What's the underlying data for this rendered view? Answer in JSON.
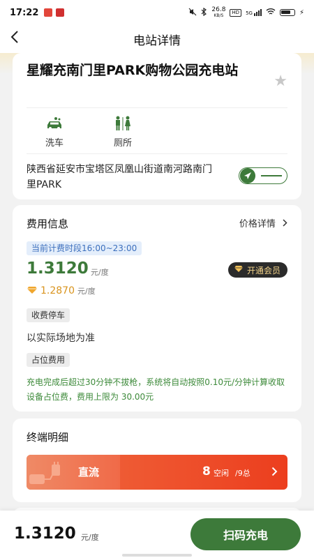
{
  "status_bar": {
    "time": "17:22",
    "net_speed": "26.8",
    "net_unit": "KB/S",
    "signal": "5G"
  },
  "header": {
    "title": "电站详情",
    "back_icon": "chevron-left-icon"
  },
  "station": {
    "name": "星耀充南门里PARK购物公园充电站",
    "amenities": [
      {
        "label": "洗车",
        "icon": "car-wash-icon"
      },
      {
        "label": "厕所",
        "icon": "restroom-icon"
      }
    ],
    "address": "陕西省延安市宝塔区凤凰山街道南河路南门里PARK"
  },
  "fee": {
    "title": "费用信息",
    "price_detail_link": "价格详情",
    "period": "当前计费时段16:00~23:00",
    "price": "1.3120",
    "price_unit": "元/度",
    "vip_button": "开通会员",
    "vip_price": "1.2870",
    "vip_unit": "元/度",
    "parking_tag": "收费停车",
    "parking_text": "以实际场地为准",
    "occupy_tag": "占位费用",
    "occupy_note": "充电完成后超过30分钟不拔枪，系统将自动按照0.10元/分钟计算收取设备占位费，费用上限为 30.00元"
  },
  "terminal": {
    "title": "终端明细",
    "type_label": "直流",
    "free_count": "8",
    "free_label": "空闲",
    "total_label": "/9总"
  },
  "bottom": {
    "price": "1.3120",
    "unit": "元/度",
    "scan_button": "扫码充电"
  },
  "colors": {
    "primary_green": "#3d7a3a",
    "terminal_orange": "#ec3e1e",
    "vip_gold": "#d9941e"
  }
}
